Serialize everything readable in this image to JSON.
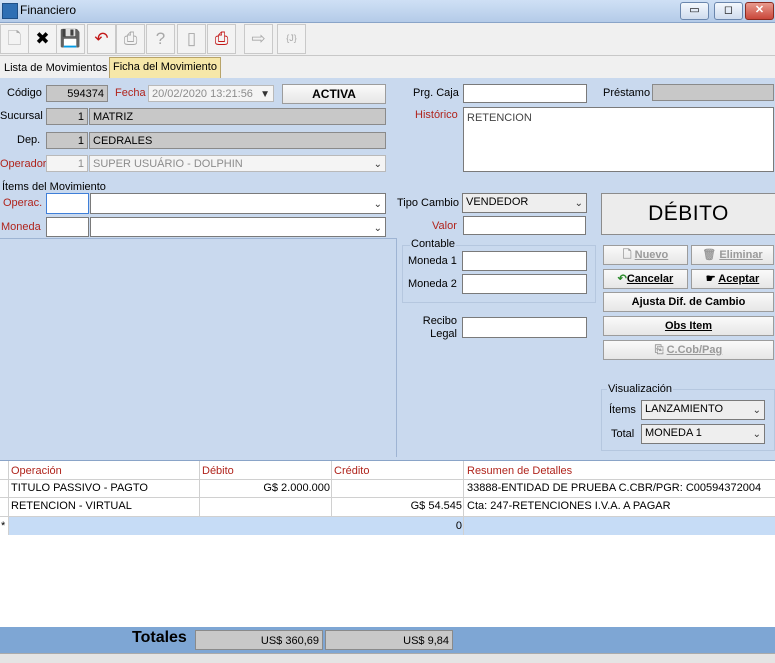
{
  "window": {
    "title": "Financiero",
    "minimize": "▭",
    "maximize": "◻",
    "close": "✕"
  },
  "tabs": [
    {
      "label": "Lista de Movimientos"
    },
    {
      "label": "Ficha del Movimiento"
    }
  ],
  "header": {
    "codigo_label": "Código",
    "codigo_value": "594374",
    "fecha_label": "Fecha",
    "fecha_value": "20/02/2020 13:21:56",
    "status": "ACTIVA",
    "sucursal_label": "Sucursal",
    "sucursal_code": "1",
    "sucursal_name": "MATRIZ",
    "dep_label": "Dep.",
    "dep_code": "1",
    "dep_name": "CEDRALES",
    "operador_label": "Operador",
    "operador_code": "1",
    "operador_name": "SUPER USUÁRIO - DOLPHIN",
    "prg_caja_label": "Prg. Caja",
    "prg_caja_value": "",
    "prestamo_label": "Préstamo",
    "prestamo_value": "",
    "historico_label": "Histórico",
    "historico_value": "RETENCION"
  },
  "items": {
    "section_label": "Ítems del Movimiento",
    "operac_label": "Operac.",
    "operac_code": "",
    "operac_value": "",
    "moneda_label": "Moneda",
    "moneda_code": "",
    "moneda_value": "",
    "tipo_cambio_label": "Tipo Cambio",
    "tipo_cambio_value": "VENDEDOR",
    "valor_label": "Valor",
    "valor_value": "",
    "contable_label": "Contable",
    "moneda1_label": "Moneda 1",
    "moneda1_value": "",
    "moneda2_label": "Moneda 2",
    "moneda2_value": "",
    "recibo_label_1": "Recibo",
    "recibo_label_2": "Legal",
    "recibo_value": ""
  },
  "actions": {
    "mode": "DÉBITO",
    "nuevo": "Nuevo",
    "eliminar": "Eliminar",
    "cancelar": "Cancelar",
    "aceptar": "Aceptar",
    "ajusta": "Ajusta Dif. de Cambio",
    "obs_item": "Obs Item",
    "c_cob_pag": "C.Cob/Pag"
  },
  "visualizacion": {
    "label": "Visualización",
    "items_label": "Ítems",
    "items_value": "LANZAMIENTO",
    "total_label": "Total",
    "total_value": "MONEDA 1"
  },
  "grid": {
    "columns": [
      "Operación",
      "Débito",
      "Crédito",
      "Resumen de Detalles"
    ],
    "rows": [
      {
        "operacion": "TITULO PASSIVO - PAGTO",
        "debito": "G$ 2.000.000",
        "credito": "",
        "resumen": "33888-ENTIDAD DE PRUEBA C.CBR/PGR: C00594372004"
      },
      {
        "operacion": "RETENCION - VIRTUAL",
        "debito": "",
        "credito": "G$ 54.545",
        "resumen": "Cta: 247-RETENCIONES I.V.A. A PAGAR"
      },
      {
        "marker": "*",
        "operacion": "",
        "debito": "",
        "credito": "0",
        "resumen": ""
      }
    ]
  },
  "totals": {
    "label": "Totales",
    "debito": "US$ 360,69",
    "credito": "US$ 9,84"
  },
  "colors": {
    "accent_red": "#b0241c",
    "selected_row": "#c6dcf6",
    "totals_bar": "#7ea6d4",
    "tab_selected": "#f6e7a8"
  }
}
